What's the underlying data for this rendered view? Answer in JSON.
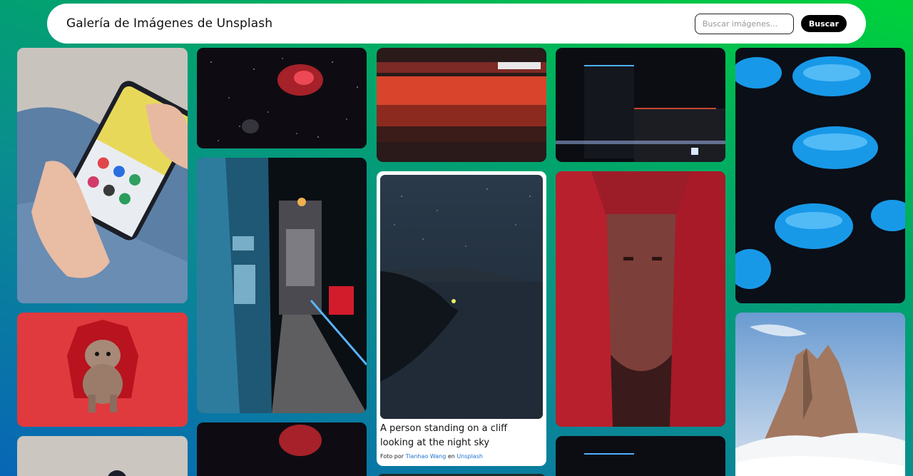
{
  "header": {
    "title": "Galería de Imágenes de Unsplash",
    "search_placeholder": "Buscar imágenes...",
    "search_button": "Buscar"
  },
  "featured": {
    "description": "A person standing on a cliff looking at the night sky",
    "credit_prefix": "Foto por",
    "photographer": "Tianhao Wang",
    "credit_middle": "en",
    "source": "Unsplash"
  },
  "colors": {
    "header_bg": "#ffffff",
    "button_bg": "#000000",
    "link": "#1a6fd0",
    "gradient_top_right": "#00d23a",
    "gradient_bottom_left": "#0866b6"
  },
  "gallery": [
    {
      "subject": "hands holding smartphone"
    },
    {
      "subject": "red nebula starfield"
    },
    {
      "subject": "red motion blur"
    },
    {
      "subject": "dark building at night"
    },
    {
      "subject": "blue jellyfish"
    },
    {
      "subject": "dog in red cape"
    },
    {
      "subject": "tower bridge at night"
    },
    {
      "subject": "woman red veil"
    },
    {
      "subject": "snowy rock peaks"
    }
  ]
}
